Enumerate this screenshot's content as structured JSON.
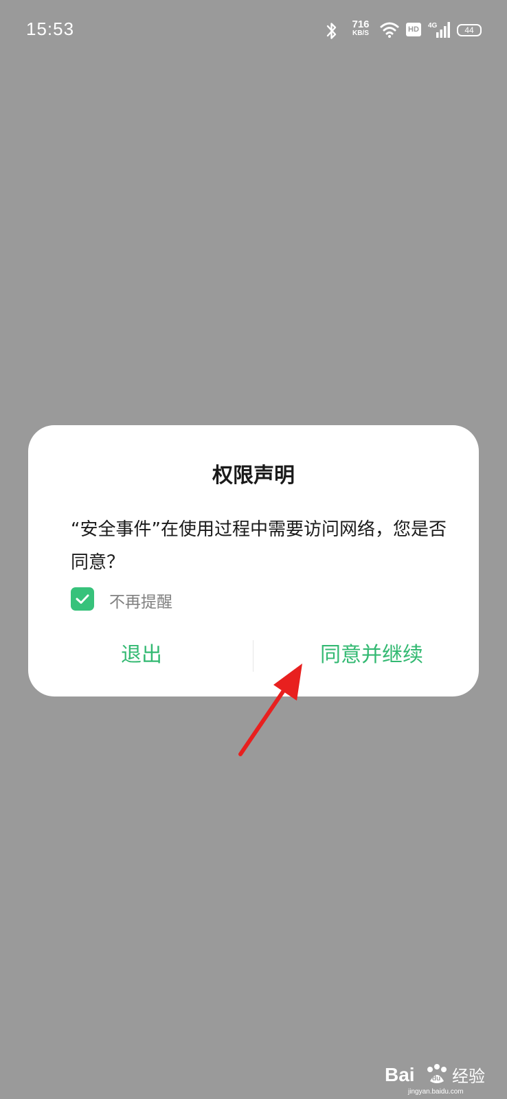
{
  "status_bar": {
    "time": "15:53",
    "net_speed_value": "716",
    "net_speed_unit": "KB/S",
    "hd_label": "HD",
    "network_label": "4G",
    "battery_level": "44",
    "icons": [
      "bluetooth-icon",
      "wifi-icon",
      "hd-icon",
      "signal-4g-icon",
      "battery-icon"
    ]
  },
  "dialog": {
    "title": "权限声明",
    "message": "“安全事件”在使用过程中需要访问网络，您是否同意？",
    "checkbox_label": "不再提醒",
    "checkbox_checked": true,
    "exit_label": "退出",
    "agree_label": "同意并继续"
  },
  "watermark": {
    "brand": "Bai",
    "brand_cn": "经验",
    "url": "jingyan.baidu.com"
  },
  "colors": {
    "background": "#9a9a9a",
    "accent_green": "#33b972",
    "arrow_red": "#e8201f"
  }
}
